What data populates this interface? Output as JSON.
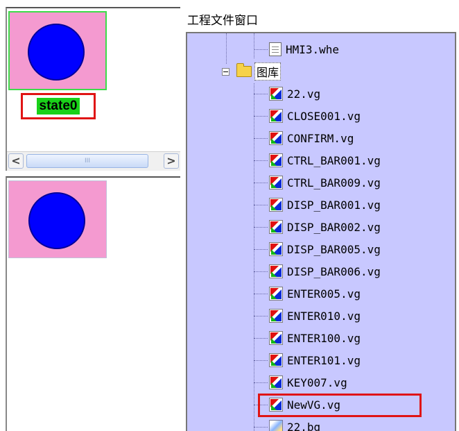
{
  "state_editor": {
    "state_label": "state0",
    "scrollbar": {
      "left_arrow": "<",
      "right_arrow": ">",
      "thumb_grip": "III"
    }
  },
  "project_panel": {
    "title": "工程文件窗口",
    "tree": {
      "top_file": "HMI3.whe",
      "folder": "图库",
      "files": [
        "22.vg",
        "CLOSE001.vg",
        "CONFIRM.vg",
        "CTRL_BAR001.vg",
        "CTRL_BAR009.vg",
        "DISP_BAR001.vg",
        "DISP_BAR002.vg",
        "DISP_BAR005.vg",
        "DISP_BAR006.vg",
        "ENTER005.vg",
        "ENTER010.vg",
        "ENTER100.vg",
        "ENTER101.vg",
        "KEY007.vg",
        "NewVG.vg"
      ],
      "last_file": "22.bg"
    }
  },
  "colors": {
    "state_background": "#f49ad0",
    "circle_fill": "#0000ff",
    "state_label_bg": "#19d119",
    "highlight_border": "#e01414",
    "tree_background": "#c8c8ff"
  }
}
